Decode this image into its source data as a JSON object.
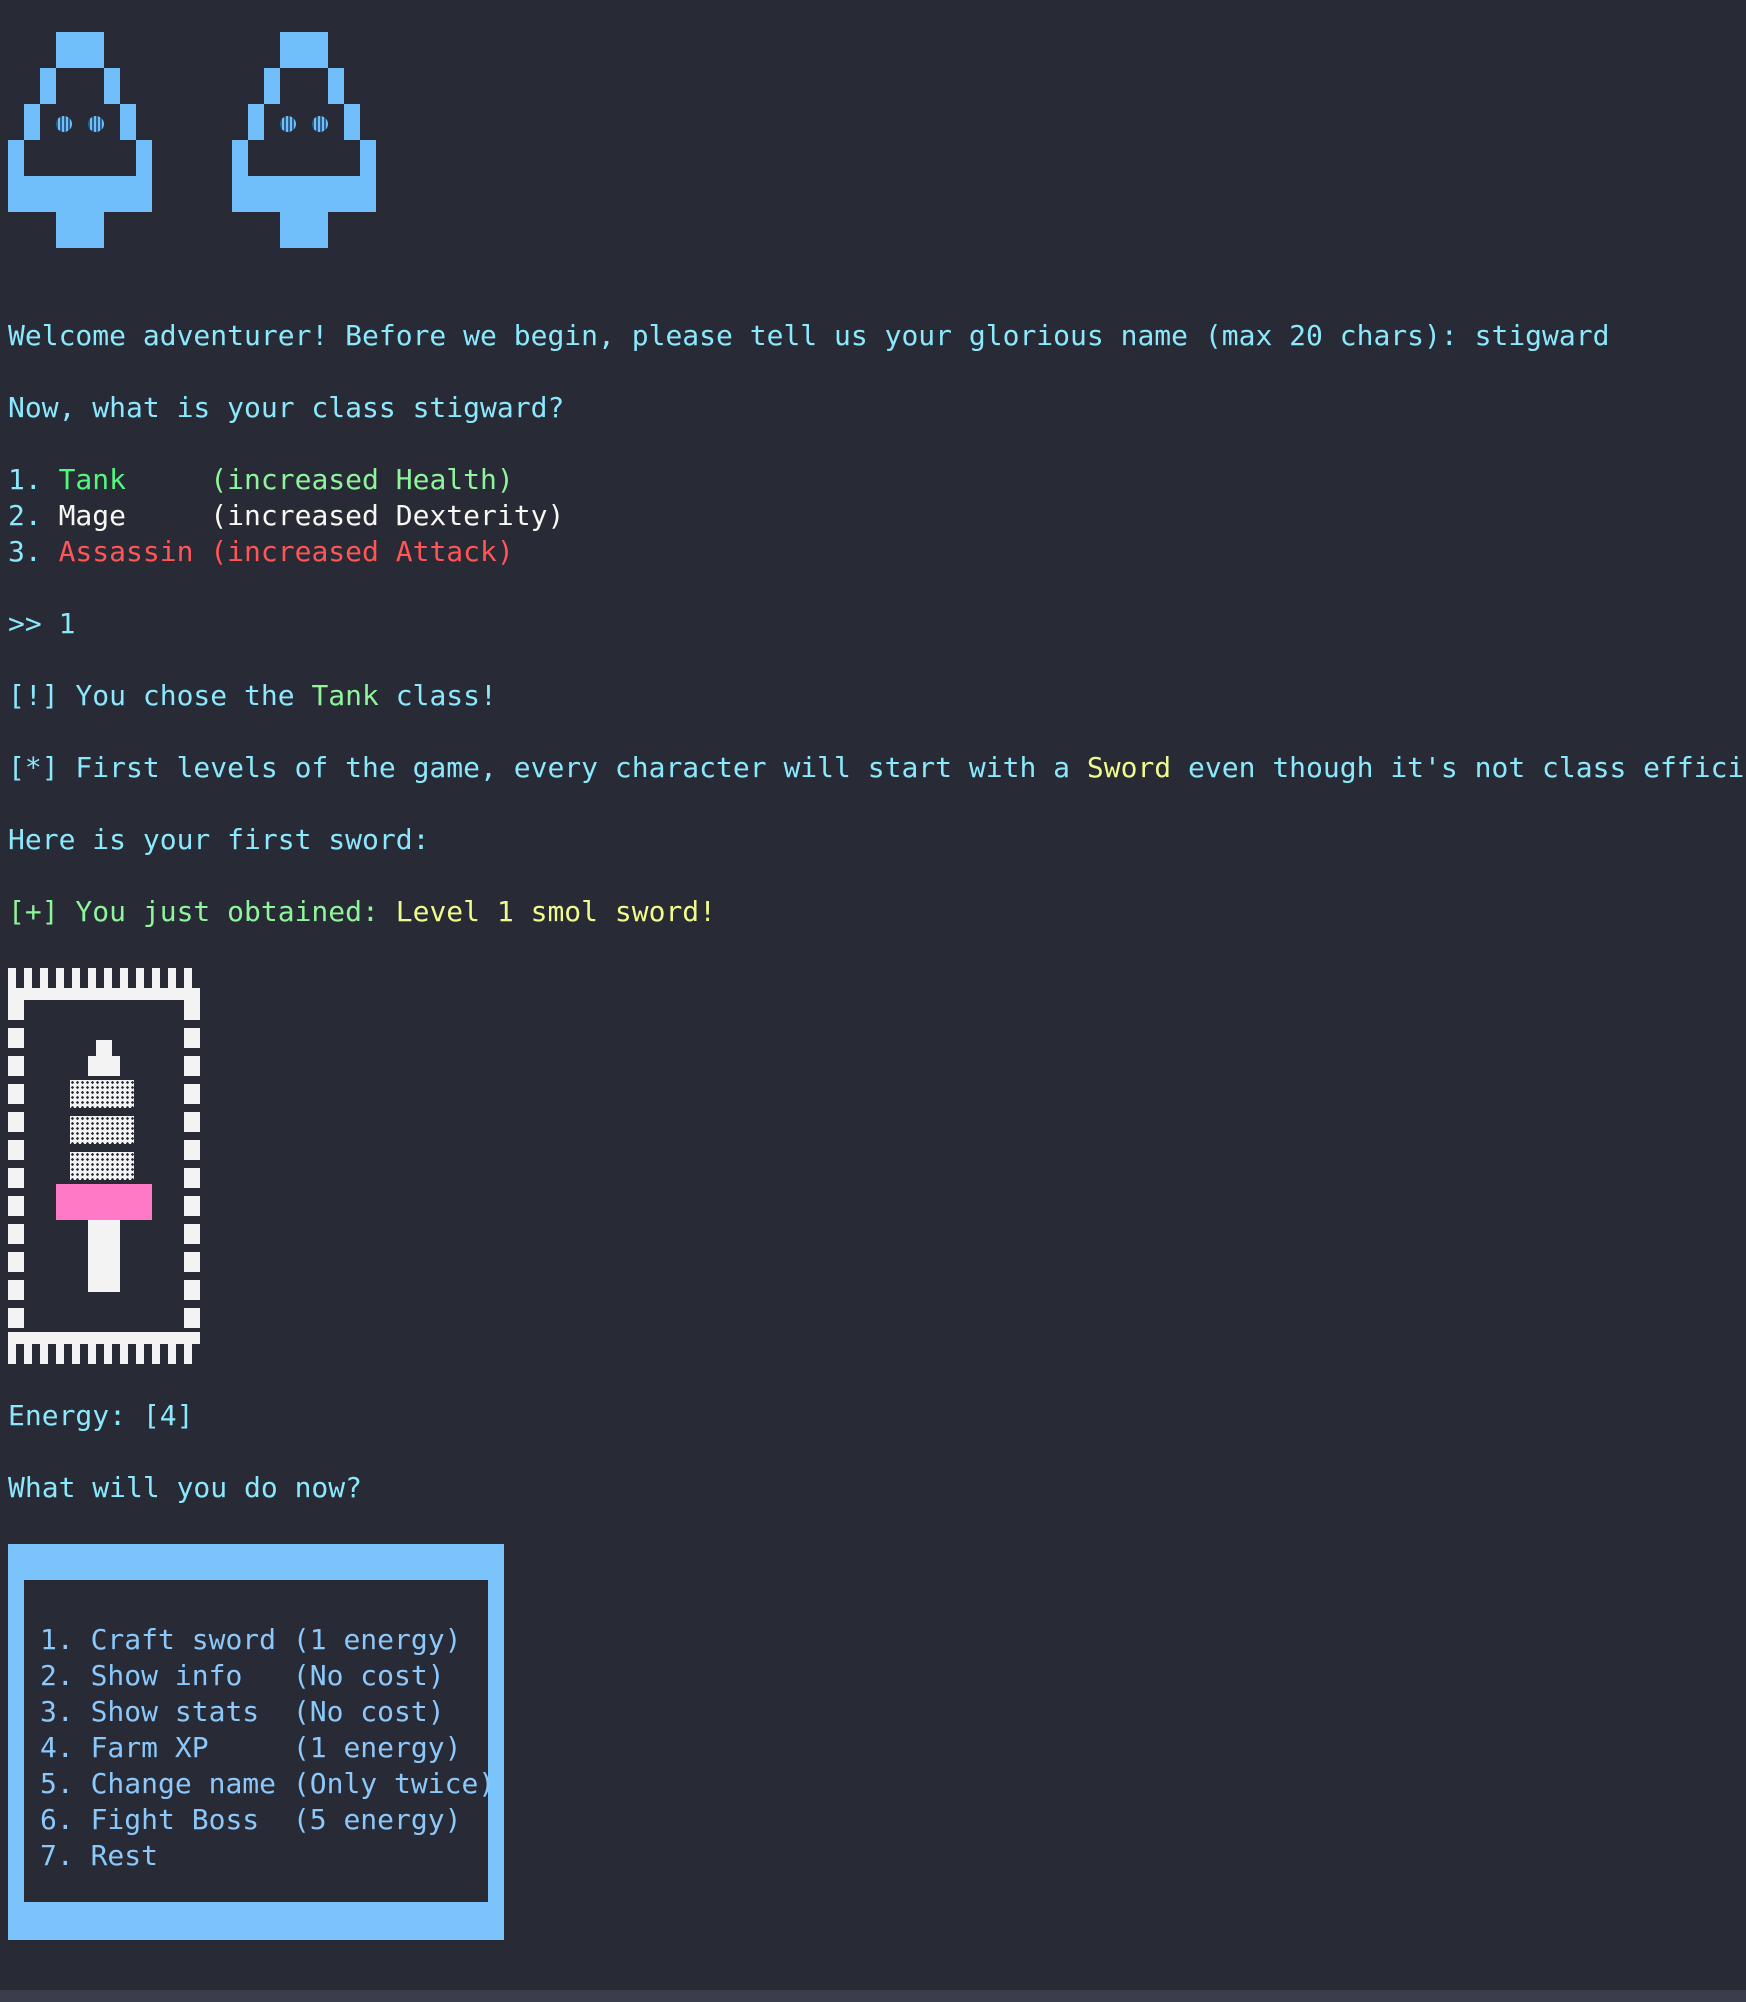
{
  "prompt": {
    "welcome_text": "Welcome adventurer! Before we begin, please tell us your glorious name (max 20 chars): ",
    "player_name": "stigward",
    "class_question": "Now, what is your class stigward?"
  },
  "classes": [
    {
      "num": "1. ",
      "name": "Tank    ",
      "desc": " (increased Health)",
      "color": "#50fa7b"
    },
    {
      "num": "2. ",
      "name": "Mage    ",
      "desc": " (increased Dexterity)",
      "color": "#f8f8f2"
    },
    {
      "num": "3. ",
      "name": "Assassin",
      "desc": " (increased Attack)",
      "color": "#ff5555"
    }
  ],
  "input": {
    "prompt_symbol": ">> ",
    "value": "1"
  },
  "messages": {
    "chose_prefix": "[!] You chose the ",
    "chose_class": "Tank",
    "chose_suffix": " class!",
    "first_levels_prefix": "[*] First levels of the game, every character will start with a ",
    "first_levels_item": "Sword",
    "first_levels_suffix": " even though it's not class efficient!",
    "here_sword": "Here is your first sword:",
    "obtained_prefix": "[+] You just obtained: ",
    "obtained_item": "Level 1 smol sword!"
  },
  "status": {
    "energy_label": "Energy: [4]",
    "what_now": "What will you do now?"
  },
  "menu": {
    "items": [
      {
        "num": "1. ",
        "label": "Craft sword ",
        "cost": "(1 energy)"
      },
      {
        "num": "2. ",
        "label": "Show info   ",
        "cost": "(No cost)"
      },
      {
        "num": "3. ",
        "label": "Show stats  ",
        "cost": "(No cost)"
      },
      {
        "num": "4. ",
        "label": "Farm XP     ",
        "cost": "(1 energy)"
      },
      {
        "num": "5. ",
        "label": "Change name ",
        "cost": "(Only twice)"
      },
      {
        "num": "6. ",
        "label": "Fight Boss  ",
        "cost": "(5 energy)"
      },
      {
        "num": "7. ",
        "label": "Rest",
        "cost": ""
      }
    ]
  },
  "colors": {
    "background": "#282a36",
    "cyan_text": "#8be9fd",
    "green_text": "#50fa7b",
    "red_text": "#ff5555",
    "yellow_text": "#f1fa8c",
    "sprite_blue": "#70bffa",
    "guard_pink": "#ff79c6"
  },
  "icons": {
    "ghost_sprite": "ghost-icon",
    "sword_sprite": "sword-icon"
  }
}
